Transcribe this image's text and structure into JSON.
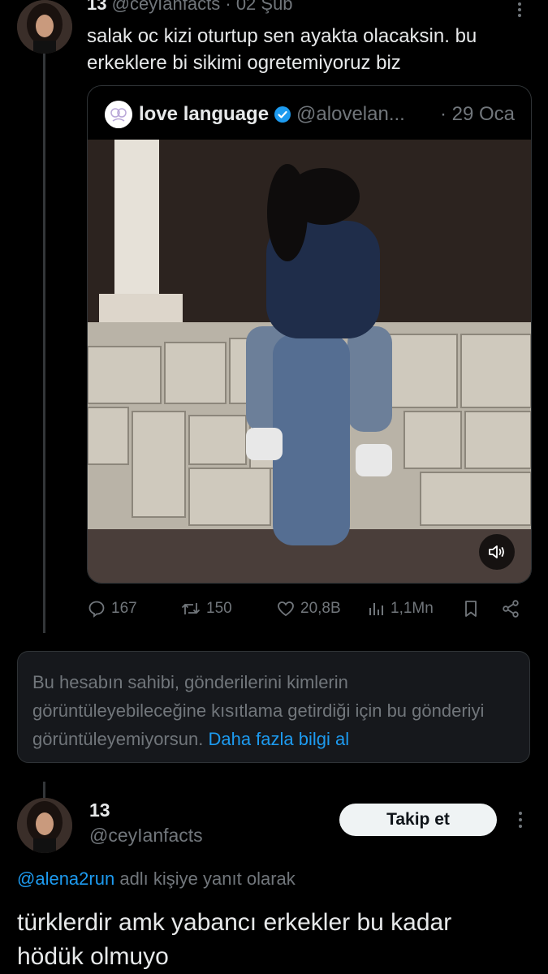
{
  "top_tweet": {
    "display_name": "13",
    "handle": "@ceyIanfacts",
    "separator": "·",
    "date": "02 Şub",
    "text_line1": "salak oc kizi oturtup sen ayakta olacaksin. bu",
    "text_line2": "erkeklere bi sikimi ogretemiyoruz biz"
  },
  "quote": {
    "display_name": "love language",
    "handle": "@alovelan...",
    "date": "· 29 Oca"
  },
  "actions": {
    "replies": "167",
    "reposts": "150",
    "likes": "20,8B",
    "views": "1,1Mn"
  },
  "notice": {
    "text": "Bu hesabın sahibi, gönderilerini kimlerin görüntüleyebileceğine kısıtlama getirdiği için bu gönderiyi görüntüleyemiyorsun.",
    "link": "Daha fazla bilgi al"
  },
  "reply_tweet": {
    "display_name": "13",
    "handle": "@ceyIanfacts",
    "follow_label": "Takip et",
    "reply_to_handle": "@alena2run",
    "reply_to_suffix": "adlı kişiye yanıt olarak",
    "text_line1": "türklerdir amk yabancı erkekler bu kadar",
    "text_line2": "hödük olmuyo"
  },
  "colors": {
    "background": "#000000",
    "text": "#e7e9ea",
    "secondary": "#71767b",
    "link": "#1d9bf0",
    "verified": "#1d9bf0"
  }
}
